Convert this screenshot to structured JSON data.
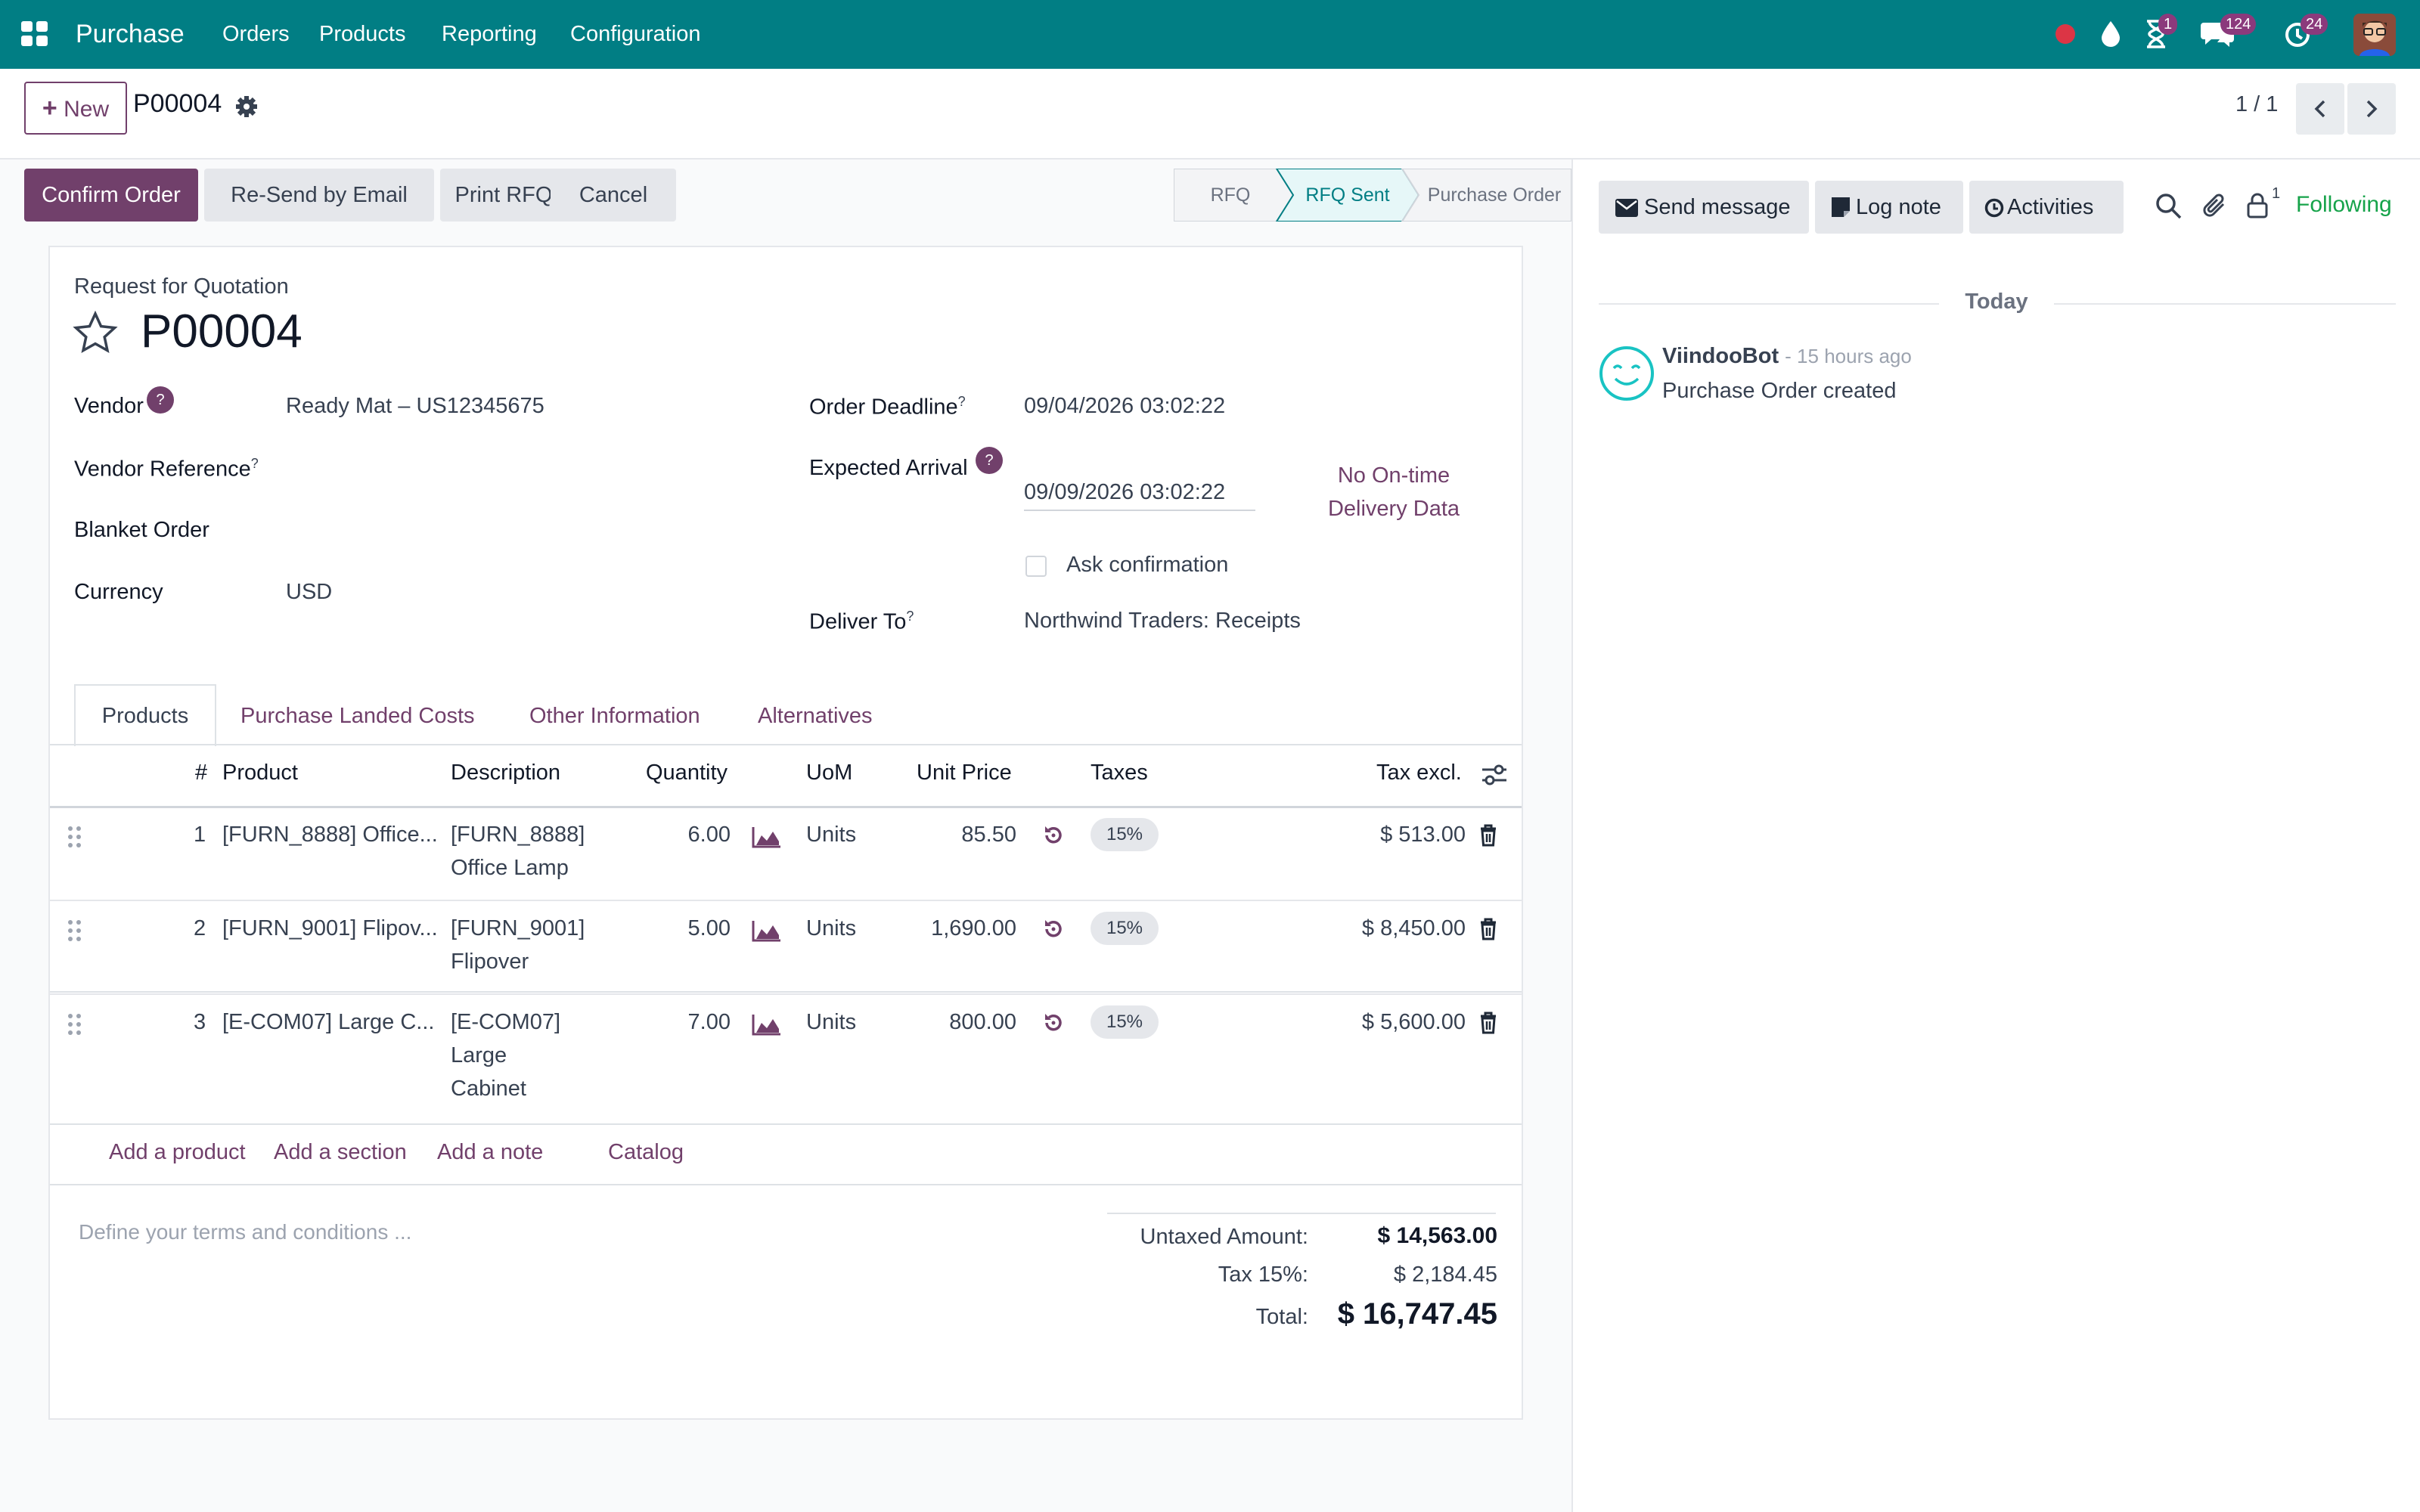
{
  "topbar": {
    "app_name": "Purchase",
    "menus": [
      "Orders",
      "Products",
      "Reporting",
      "Configuration"
    ],
    "activity_badge": "1",
    "messages_badge": "124",
    "clock_badge": "24",
    "icons": [
      "apps-grid-icon",
      "status-dot-icon",
      "drop-icon",
      "hourglass-icon",
      "chat-icon",
      "clock-icon",
      "avatar"
    ]
  },
  "control_panel": {
    "new_label": "New",
    "record_name": "P00004",
    "pager": "1 / 1"
  },
  "statusbar": {
    "buttons": [
      "Confirm Order",
      "Re-Send by Email",
      "Print RFQ",
      "Cancel"
    ],
    "stages": [
      "RFQ",
      "RFQ Sent",
      "Purchase Order"
    ],
    "active_stage": "RFQ Sent"
  },
  "form": {
    "subtitle": "Request for Quotation",
    "name": "P00004",
    "vendor_label": "Vendor",
    "vendor_value": "Ready Mat – US12345675",
    "vendor_ref_label": "Vendor Reference",
    "blanket_label": "Blanket Order",
    "currency_label": "Currency",
    "currency_value": "USD",
    "deadline_label": "Order Deadline",
    "deadline_value": "09/04/2026 03:02:22",
    "arrival_label": "Expected Arrival",
    "arrival_value": "09/09/2026 03:02:22",
    "ontime_line1": "No On-time",
    "ontime_line2": "Delivery Data",
    "ask_confirmation": "Ask confirmation",
    "deliver_label": "Deliver To",
    "deliver_value": "Northwind Traders: Receipts",
    "tooltip_mark": "?"
  },
  "tabs": [
    "Products",
    "Purchase Landed Costs",
    "Other Information",
    "Alternatives"
  ],
  "table": {
    "headers": [
      "#",
      "Product",
      "Description",
      "Quantity",
      "UoM",
      "Unit Price",
      "Taxes",
      "Tax excl."
    ],
    "rows": [
      {
        "num": "1",
        "product": "[FURN_8888] Office...",
        "desc": [
          "[FURN_8888]",
          "Office Lamp"
        ],
        "qty": "6.00",
        "uom": "Units",
        "price": "85.50",
        "tax": "15%",
        "subtotal": "$ 513.00"
      },
      {
        "num": "2",
        "product": "[FURN_9001] Flipov...",
        "desc": [
          "[FURN_9001]",
          "Flipover"
        ],
        "qty": "5.00",
        "uom": "Units",
        "price": "1,690.00",
        "tax": "15%",
        "subtotal": "$ 8,450.00"
      },
      {
        "num": "3",
        "product": "[E-COM07] Large C...",
        "desc": [
          "[E-COM07]",
          "Large",
          "Cabinet"
        ],
        "qty": "7.00",
        "uom": "Units",
        "price": "800.00",
        "tax": "15%",
        "subtotal": "$ 5,600.00"
      }
    ],
    "actions": [
      "Add a product",
      "Add a section",
      "Add a note",
      "Catalog"
    ]
  },
  "terms_placeholder": "Define your terms and conditions ...",
  "totals": {
    "untaxed_label": "Untaxed Amount:",
    "untaxed_value": "$ 14,563.00",
    "tax_label": "Tax 15%:",
    "tax_value": "$ 2,184.45",
    "total_label": "Total:",
    "total_value": "$ 16,747.45"
  },
  "chatter": {
    "send_message": "Send message",
    "log_note": "Log note",
    "activities": "Activities",
    "followers_count": "1",
    "following": "Following",
    "date_separator": "Today",
    "message": {
      "author": "ViindooBot",
      "time": "- 15 hours ago",
      "body": "Purchase Order created"
    }
  },
  "colors": {
    "navbar": "#017e84",
    "primary": "#71406b",
    "active_stage": "#e6f7f8",
    "following": "#16a34a"
  }
}
